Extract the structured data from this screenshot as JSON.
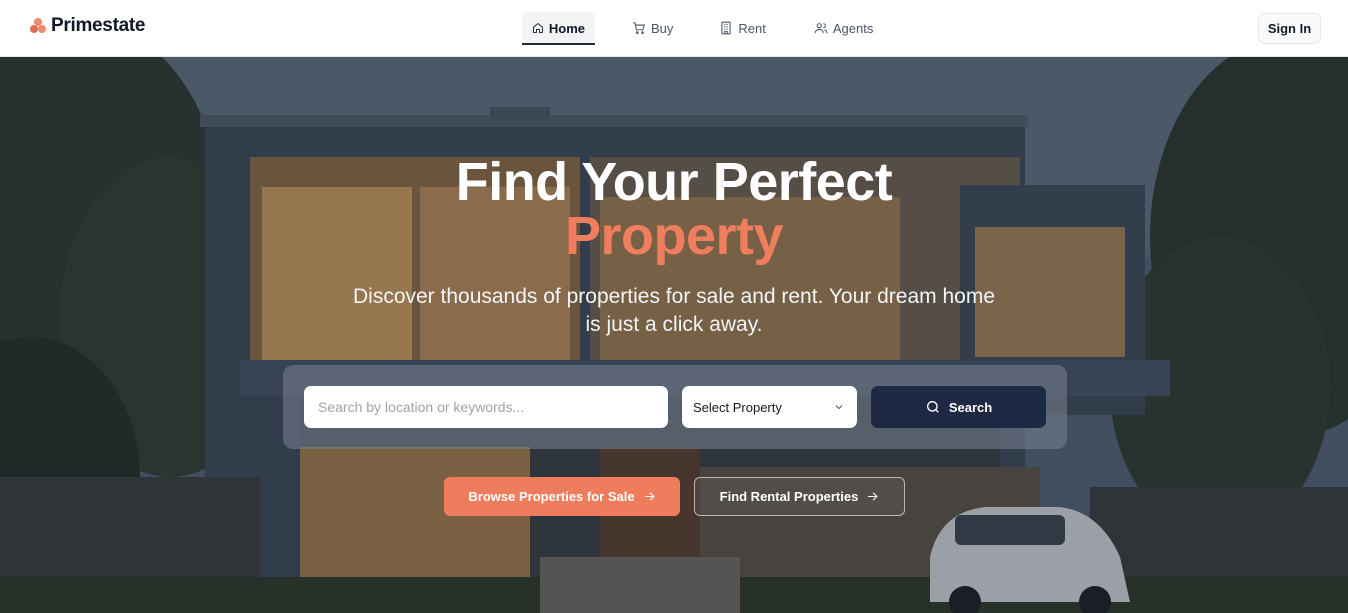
{
  "brand": {
    "name": "Primestate",
    "accent": "#ee7e5e",
    "dark": "#1e2a44"
  },
  "nav": {
    "items": [
      {
        "label": "Home",
        "icon": "home-icon",
        "active": true
      },
      {
        "label": "Buy",
        "icon": "cart-icon",
        "active": false
      },
      {
        "label": "Rent",
        "icon": "building-icon",
        "active": false
      },
      {
        "label": "Agents",
        "icon": "users-icon",
        "active": false
      }
    ],
    "sign_in": "Sign In"
  },
  "hero": {
    "title_line1": "Find Your Perfect",
    "title_line2": "Property",
    "subtitle": "Discover thousands of properties for sale and rent. Your dream home is just a click away.",
    "search": {
      "placeholder": "Search by location or keywords...",
      "value": "",
      "select_value": "Select Property",
      "button_label": "Search"
    },
    "cta_sale": "Browse Properties for Sale",
    "cta_rent": "Find Rental Properties"
  }
}
